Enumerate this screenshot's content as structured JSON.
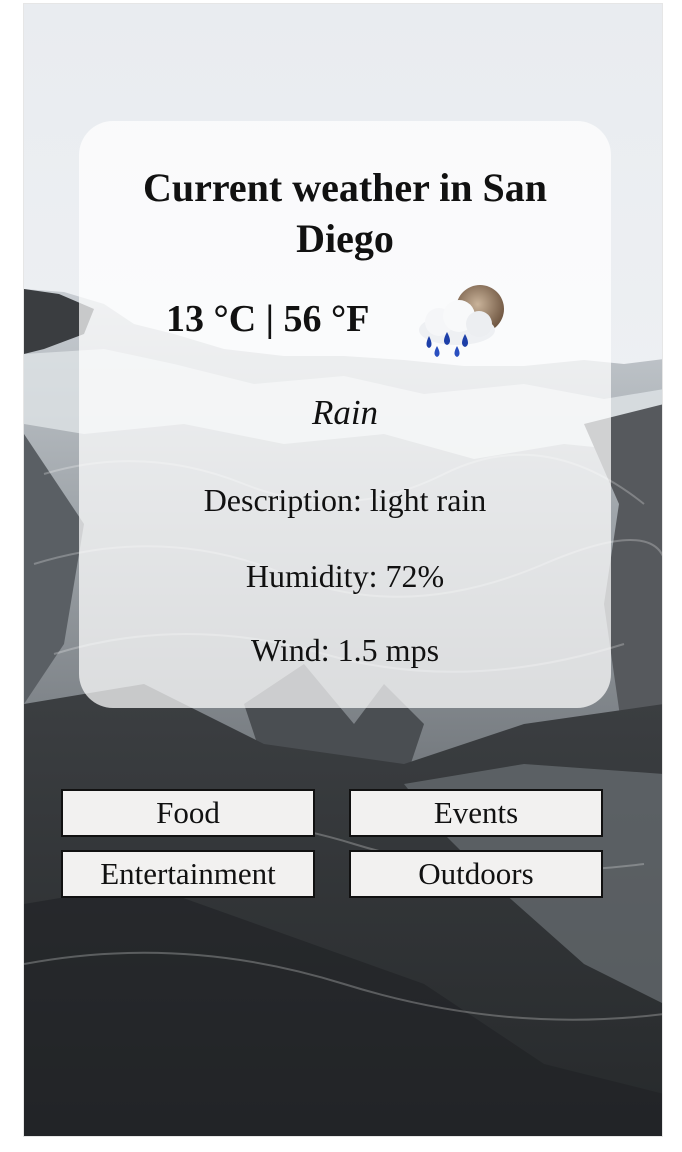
{
  "weather": {
    "title": "Current weather in San Diego",
    "temperature": "13 °C | 56 °F",
    "condition": "Rain",
    "description": "Description: light rain",
    "humidity": "Humidity: 72%",
    "wind": "Wind: 1.5 mps",
    "icon": "rain-cloud-icon"
  },
  "categories": {
    "food": "Food",
    "events": "Events",
    "entertainment": "Entertainment",
    "outdoors": "Outdoors"
  }
}
